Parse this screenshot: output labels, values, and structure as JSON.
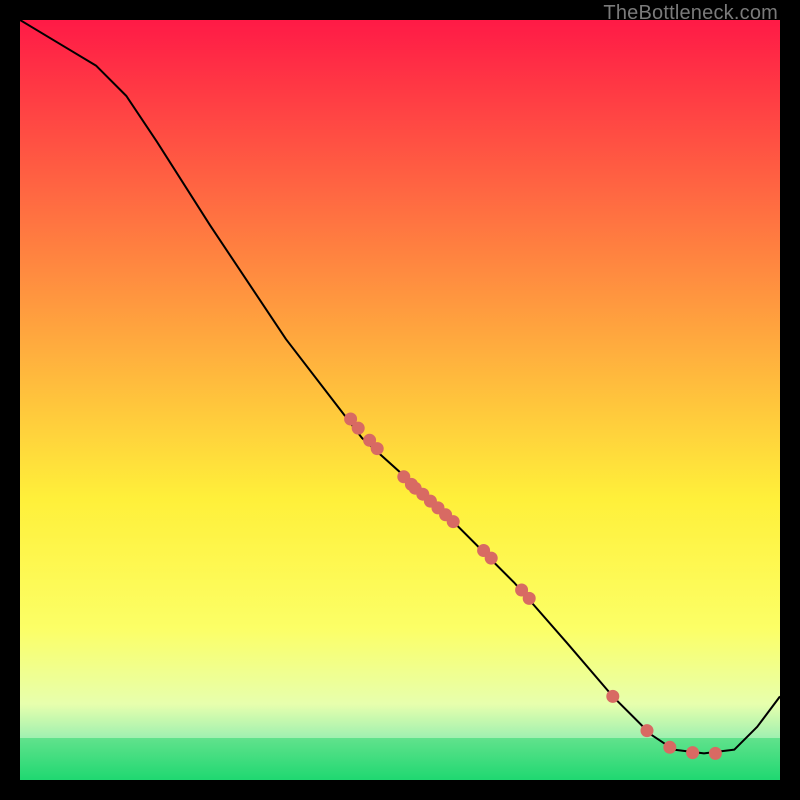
{
  "watermark": "TheBottleneck.com",
  "colors": {
    "gradient_top": "#ff1a46",
    "gradient_mid_upper": "#ff7a3a",
    "gradient_mid": "#ffd23a",
    "gradient_mid_lower": "#fff03a",
    "gradient_band_pale": "#f6ffb0",
    "gradient_green_light": "#7fe8a0",
    "gradient_green": "#1fd871",
    "curve": "#000000",
    "marker": "#d86a63",
    "frame": "#000000"
  },
  "chart_data": {
    "type": "line",
    "title": "",
    "xlabel": "",
    "ylabel": "",
    "xlim": [
      0,
      100
    ],
    "ylim": [
      0,
      100
    ],
    "curve": [
      {
        "x": 0,
        "y": 100
      },
      {
        "x": 5,
        "y": 97
      },
      {
        "x": 10,
        "y": 94
      },
      {
        "x": 14,
        "y": 90
      },
      {
        "x": 18,
        "y": 84
      },
      {
        "x": 25,
        "y": 73
      },
      {
        "x": 35,
        "y": 58
      },
      {
        "x": 45,
        "y": 45
      },
      {
        "x": 55,
        "y": 36
      },
      {
        "x": 65,
        "y": 26
      },
      {
        "x": 72,
        "y": 18
      },
      {
        "x": 78,
        "y": 11
      },
      {
        "x": 83,
        "y": 6
      },
      {
        "x": 86,
        "y": 4
      },
      {
        "x": 90,
        "y": 3.5
      },
      {
        "x": 94,
        "y": 4
      },
      {
        "x": 97,
        "y": 7
      },
      {
        "x": 100,
        "y": 11
      }
    ],
    "markers": [
      {
        "x": 43.5,
        "y": 47.5
      },
      {
        "x": 44.5,
        "y": 46.3
      },
      {
        "x": 46.0,
        "y": 44.7
      },
      {
        "x": 47.0,
        "y": 43.6
      },
      {
        "x": 50.5,
        "y": 39.9
      },
      {
        "x": 51.5,
        "y": 38.9
      },
      {
        "x": 52.0,
        "y": 38.4
      },
      {
        "x": 53.0,
        "y": 37.6
      },
      {
        "x": 54.0,
        "y": 36.7
      },
      {
        "x": 55.0,
        "y": 35.8
      },
      {
        "x": 56.0,
        "y": 34.9
      },
      {
        "x": 57.0,
        "y": 34.0
      },
      {
        "x": 61.0,
        "y": 30.2
      },
      {
        "x": 62.0,
        "y": 29.2
      },
      {
        "x": 66.0,
        "y": 25.0
      },
      {
        "x": 67.0,
        "y": 23.9
      },
      {
        "x": 78.0,
        "y": 11.0
      },
      {
        "x": 82.5,
        "y": 6.5
      },
      {
        "x": 85.5,
        "y": 4.3
      },
      {
        "x": 88.5,
        "y": 3.6
      },
      {
        "x": 91.5,
        "y": 3.5
      }
    ],
    "marker_radius": 6.5,
    "gradient_bands": [
      {
        "from": 0.0,
        "to": 0.63,
        "top_color": "#ff1a46",
        "bottom_color": "#fff03a"
      },
      {
        "from": 0.63,
        "to": 0.8,
        "top_color": "#fff03a",
        "bottom_color": "#fcff66"
      },
      {
        "from": 0.8,
        "to": 0.9,
        "top_color": "#fcff66",
        "bottom_color": "#e7ffad"
      },
      {
        "from": 0.9,
        "to": 0.945,
        "top_color": "#e7ffad",
        "bottom_color": "#9ff0b0"
      },
      {
        "from": 0.945,
        "to": 1.0,
        "top_color": "#61e28c",
        "bottom_color": "#1fd871"
      }
    ]
  }
}
